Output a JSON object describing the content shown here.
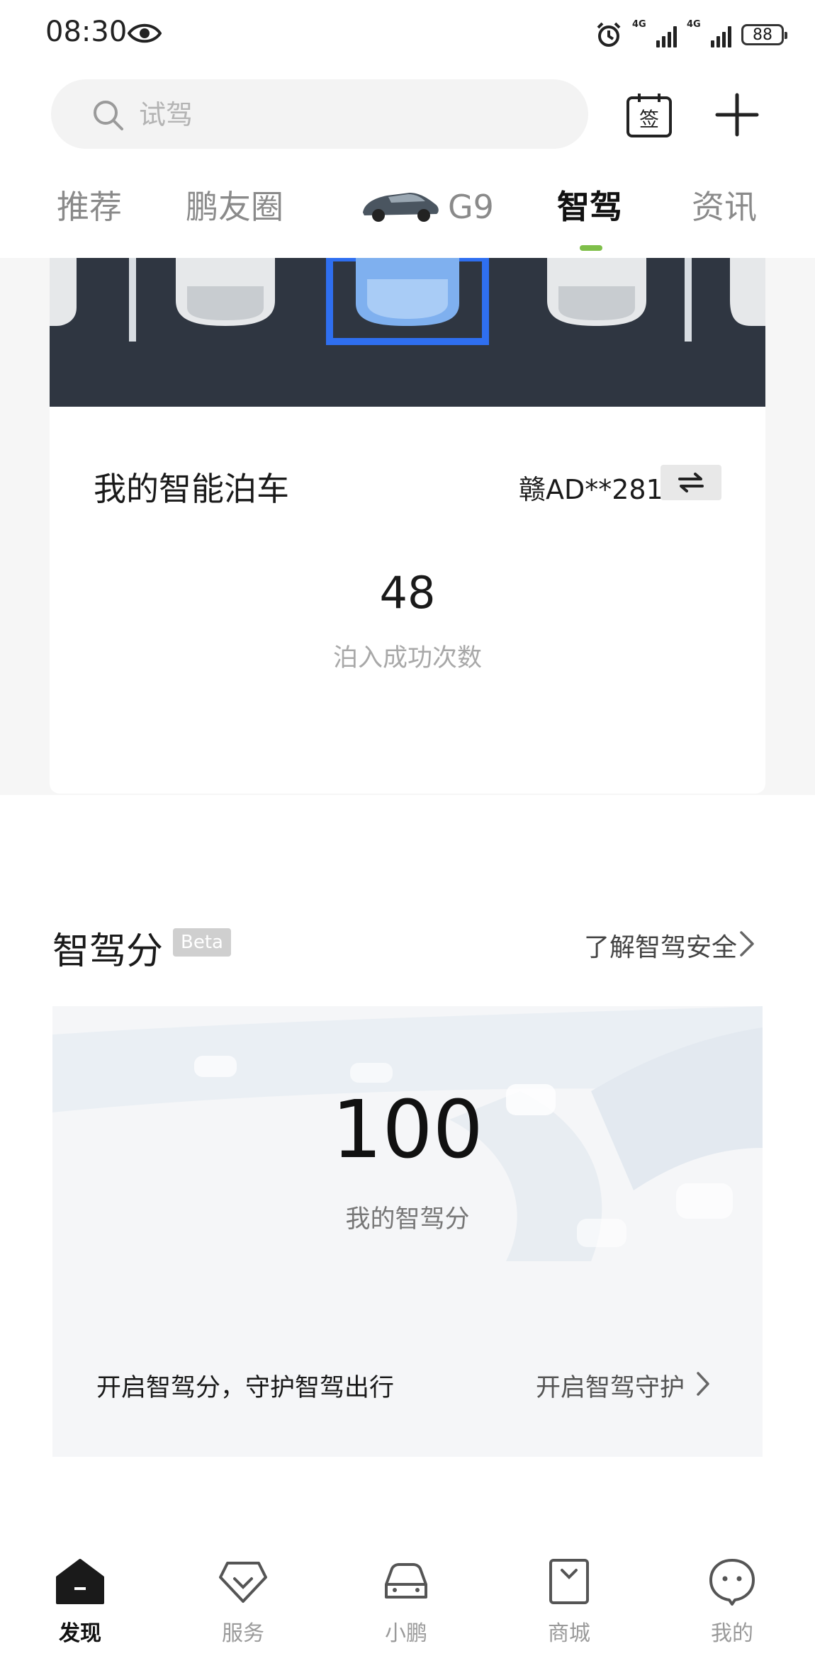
{
  "status": {
    "time": "08:30",
    "network_1": "4G",
    "network_2": "4G",
    "battery": "88"
  },
  "search": {
    "placeholder": "试驾"
  },
  "calendar": {
    "label": "签"
  },
  "tabs": [
    {
      "label": "推荐"
    },
    {
      "label": "鹏友圈"
    },
    {
      "label": "G9"
    },
    {
      "label": "智驾"
    },
    {
      "label": "资讯"
    }
  ],
  "parking": {
    "title": "我的智能泊车",
    "plate": "赣AD**281",
    "count": "48",
    "count_label": "泊入成功次数"
  },
  "score_section": {
    "title": "智驾分",
    "badge": "Beta",
    "learn_more": "了解智驾安全",
    "value": "100",
    "value_label": "我的智驾分",
    "enable_text": "开启智驾分，守护智驾出行",
    "enable_link": "开启智驾守护"
  },
  "nav": [
    {
      "label": "发现"
    },
    {
      "label": "服务"
    },
    {
      "label": "小鹏"
    },
    {
      "label": "商城"
    },
    {
      "label": "我的"
    }
  ]
}
